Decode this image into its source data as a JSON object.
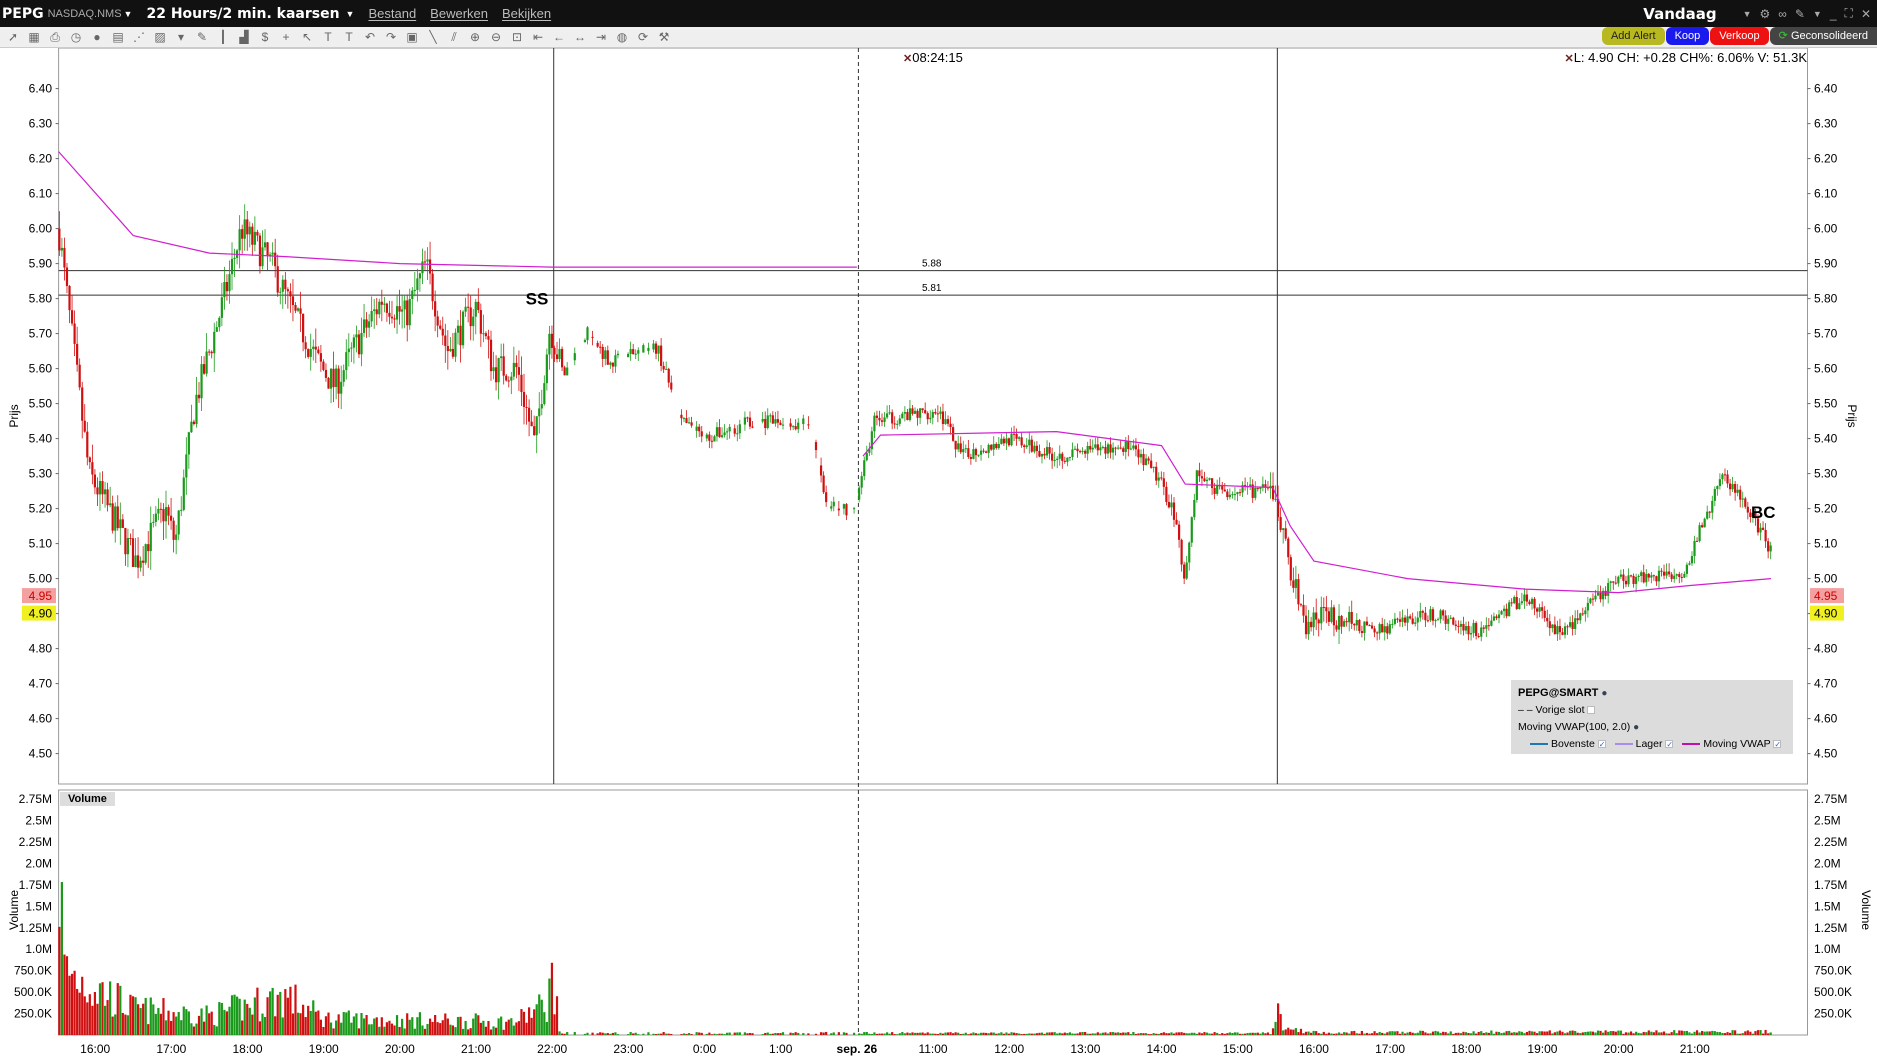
{
  "header": {
    "symbol": "PEPG",
    "exchange": "NASDAQ.NMS",
    "period": "22 Hours/2 min. kaarsen",
    "menus": [
      "Bestand",
      "Bewerken",
      "Bekijken"
    ],
    "range": "Vandaag"
  },
  "toolbar_icons": [
    "cursor-icon",
    "grid-icon",
    "print-icon",
    "clock-icon",
    "circle-icon",
    "chart-settings-icon",
    "compare-icon",
    "layout-icon",
    "dropdown-icon",
    "pencil-icon",
    "bars-icon",
    "volume-icon",
    "dollar-icon",
    "crosshair-icon",
    "arrow-icon",
    "text-icon",
    "text-note-icon",
    "undo-icon",
    "redo-icon",
    "annotation-icon",
    "line-icon",
    "fan-icon",
    "zoom-in-icon",
    "zoom-out-icon",
    "fit-icon",
    "scroll-start-icon",
    "scroll-left-icon",
    "scroll-both-icon",
    "scroll-end-icon",
    "globe-icon",
    "refresh-icon",
    "wrench-icon"
  ],
  "actions": {
    "add_alert": "Add Alert",
    "buy": "Koop",
    "sell": "Verkoop",
    "consolidated": "Geconsolideerd"
  },
  "readout": "L: 4.90 CH: +0.28 CH%: 6.06% V: 51.3K",
  "crosshair_time": "08:24:15",
  "axes": {
    "price_label": "Prijs",
    "volume_label": "Volume",
    "price_ticks": [
      "6.40",
      "6.30",
      "6.20",
      "6.10",
      "6.00",
      "5.90",
      "5.80",
      "5.70",
      "5.60",
      "5.50",
      "5.40",
      "5.30",
      "5.20",
      "5.10",
      "5.00",
      "4.90",
      "4.80",
      "4.70",
      "4.60",
      "4.50"
    ],
    "volume_ticks": [
      "2.75M",
      "2.5M",
      "2.25M",
      "2.0M",
      "1.75M",
      "1.5M",
      "1.25M",
      "1.0M",
      "750.0K",
      "500.0K",
      "250.0K"
    ],
    "time_ticks": [
      "16:00",
      "17:00",
      "18:00",
      "19:00",
      "20:00",
      "21:00",
      "22:00",
      "23:00",
      "0:00",
      "1:00",
      "sep. 26",
      "11:00",
      "12:00",
      "13:00",
      "14:00",
      "15:00",
      "16:00",
      "17:00",
      "18:00",
      "19:00",
      "20:00",
      "21:00"
    ],
    "last_price": "4.90",
    "prev_tag": "4.95"
  },
  "hlines": [
    {
      "value": 5.88,
      "label": "5.88"
    },
    {
      "value": 5.81,
      "label": "5.81"
    }
  ],
  "markers": [
    {
      "text": "SS",
      "h": 5.8,
      "price": 5.8
    },
    {
      "text": "BC",
      "h": 21.9,
      "price": 5.19
    }
  ],
  "legend": {
    "title": "PEPG@SMART",
    "prev_close": "Vorige slot",
    "indicator": "Moving VWAP(100, 2.0)",
    "upper": "Bovenste",
    "lower": "Lager",
    "vwap": "Moving VWAP"
  },
  "colors": {
    "up": "#1a9a1a",
    "down": "#d01010",
    "vwap": "#d020d0",
    "upper": "#1f77b4",
    "lower": "#a88cf0"
  },
  "chart_data": {
    "type": "candlestick",
    "x_unit": "session hours from 16:00",
    "price_range": [
      4.42,
      6.5
    ],
    "volume_range": [
      0,
      2.9
    ],
    "price_path": [
      [
        -0.48,
        6.0
      ],
      [
        -0.08,
        5.3
      ],
      [
        0.54,
        5.05
      ],
      [
        0.92,
        5.2
      ],
      [
        1.05,
        5.1
      ],
      [
        1.31,
        5.5
      ],
      [
        1.69,
        5.8
      ],
      [
        1.92,
        6.0
      ],
      [
        2.31,
        5.9
      ],
      [
        2.62,
        5.75
      ],
      [
        2.92,
        5.62
      ],
      [
        3.15,
        5.55
      ],
      [
        3.38,
        5.65
      ],
      [
        3.77,
        5.8
      ],
      [
        4.08,
        5.75
      ],
      [
        4.34,
        5.9
      ],
      [
        4.62,
        5.65
      ],
      [
        5.0,
        5.78
      ],
      [
        5.23,
        5.6
      ],
      [
        5.54,
        5.6
      ],
      [
        5.77,
        5.38
      ],
      [
        5.97,
        5.72
      ],
      [
        6.15,
        5.58
      ],
      [
        6.46,
        5.7
      ],
      [
        6.77,
        5.62
      ],
      [
        7.38,
        5.66
      ],
      [
        7.69,
        5.45
      ],
      [
        8.0,
        5.4
      ],
      [
        8.62,
        5.45
      ],
      [
        9.38,
        5.44
      ],
      [
        9.62,
        5.2
      ],
      [
        9.97,
        5.2
      ],
      [
        10.23,
        5.45
      ],
      [
        11.08,
        5.48
      ],
      [
        11.38,
        5.35
      ],
      [
        12.0,
        5.4
      ],
      [
        12.62,
        5.35
      ],
      [
        13.54,
        5.38
      ],
      [
        13.92,
        5.3
      ],
      [
        14.15,
        5.2
      ],
      [
        14.31,
        5.0
      ],
      [
        14.46,
        5.3
      ],
      [
        14.77,
        5.25
      ],
      [
        15.46,
        5.25
      ],
      [
        15.62,
        5.1
      ],
      [
        15.88,
        4.86
      ],
      [
        16.15,
        4.9
      ],
      [
        16.77,
        4.85
      ],
      [
        17.54,
        4.9
      ],
      [
        18.15,
        4.85
      ],
      [
        18.77,
        4.95
      ],
      [
        19.23,
        4.84
      ],
      [
        20.0,
        5.0
      ],
      [
        20.85,
        5.02
      ],
      [
        21.38,
        5.3
      ],
      [
        21.69,
        5.2
      ],
      [
        22.0,
        5.08
      ]
    ],
    "vwap_session1": [
      [
        -0.48,
        6.22
      ],
      [
        0.5,
        5.98
      ],
      [
        1.5,
        5.93
      ],
      [
        2.5,
        5.92
      ],
      [
        4.0,
        5.9
      ],
      [
        6.0,
        5.89
      ],
      [
        10.0,
        5.89
      ]
    ],
    "vwap_session2": [
      [
        10.08,
        5.35
      ],
      [
        10.31,
        5.41
      ],
      [
        12.62,
        5.42
      ],
      [
        14.0,
        5.38
      ],
      [
        14.31,
        5.27
      ],
      [
        15.46,
        5.26
      ],
      [
        15.69,
        5.15
      ],
      [
        16.0,
        5.05
      ],
      [
        17.23,
        5.0
      ],
      [
        18.77,
        4.97
      ],
      [
        20.0,
        4.96
      ],
      [
        20.92,
        4.98
      ],
      [
        22.0,
        5.0
      ]
    ],
    "volume_profile": [
      [
        -0.48,
        2.8
      ],
      [
        -0.4,
        1.0
      ],
      [
        0.5,
        0.4
      ],
      [
        1.5,
        0.3
      ],
      [
        2.5,
        0.6
      ],
      [
        3.0,
        0.25
      ],
      [
        5.5,
        0.2
      ],
      [
        5.95,
        0.5
      ],
      [
        6.0,
        1.0
      ],
      [
        6.1,
        0.03
      ],
      [
        15.45,
        0.03
      ],
      [
        15.5,
        0.5
      ],
      [
        15.6,
        0.1
      ],
      [
        16.0,
        0.04
      ],
      [
        22.0,
        0.05
      ]
    ],
    "crosshair_lines": [
      6.02,
      15.52
    ],
    "dashed_line": 10.02
  }
}
